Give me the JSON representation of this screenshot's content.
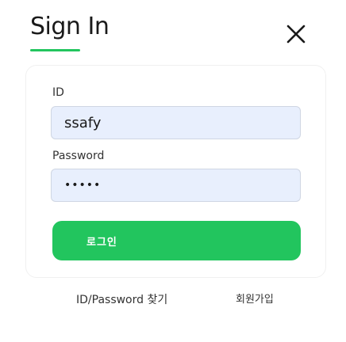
{
  "header": {
    "title": "Sign In"
  },
  "icons": {
    "close": "close-icon"
  },
  "colors": {
    "accent": "#22c55e",
    "input_bg": "#e8effd"
  },
  "form": {
    "id_label": "ID",
    "id_value": "ssafy",
    "password_label": "Password",
    "password_value": "•••••",
    "login_label": "로그인"
  },
  "footer": {
    "find_label": "ID/Password 찾기",
    "signup_label": "회원가입"
  }
}
